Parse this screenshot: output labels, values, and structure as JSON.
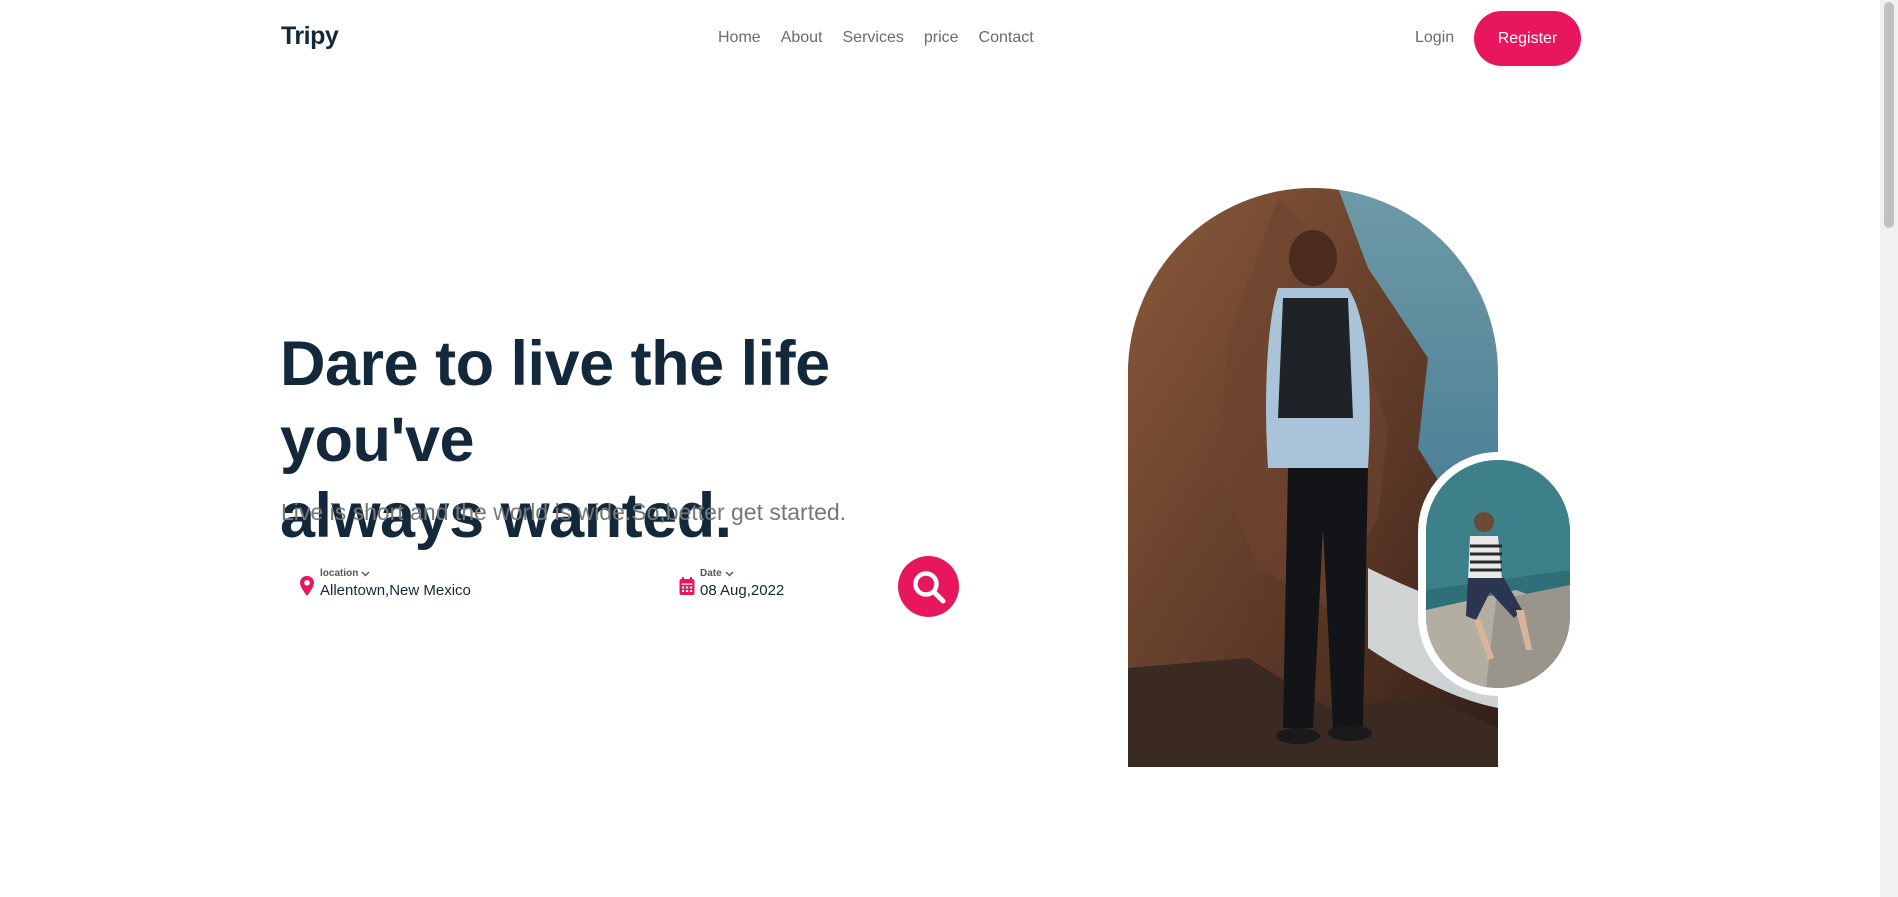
{
  "brand": {
    "logo": "Tripy"
  },
  "nav": {
    "items": [
      "Home",
      "About",
      "Services",
      "price",
      "Contact"
    ],
    "login_label": "Login",
    "register_label": "Register"
  },
  "hero": {
    "title_line1": "Dare to live the life you've",
    "title_line2": "always wanted.",
    "subtitle": "Live is short and the world is wide.So,better get started."
  },
  "search": {
    "location_label": "location",
    "location_value": "Allentown,New Mexico",
    "date_label": "Date",
    "date_value": "08 Aug,2022"
  },
  "colors": {
    "accent": "#e8175d",
    "heading": "#14283b",
    "muted": "#777777"
  },
  "icons": [
    "location-pin-icon",
    "calendar-icon",
    "search-icon",
    "chevron-down-icon"
  ]
}
